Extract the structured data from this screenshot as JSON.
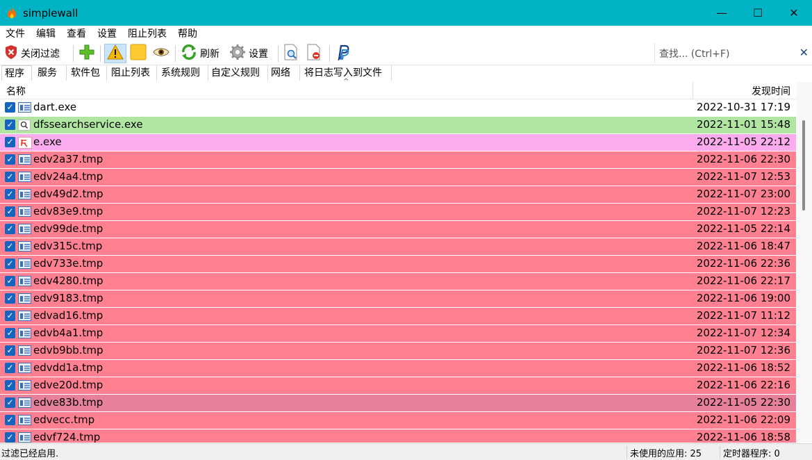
{
  "window": {
    "title": "simplewall",
    "minimize": "—",
    "maximize": "☐",
    "close": "✕"
  },
  "menu": [
    "文件",
    "编辑",
    "查看",
    "设置",
    "阻止列表",
    "帮助"
  ],
  "toolbar": {
    "disable_filter_label": "关闭过滤",
    "refresh_label": "刷新",
    "settings_label": "设置"
  },
  "search": {
    "placeholder": "查找... (Ctrl+F)",
    "clear": "✕"
  },
  "tabs": [
    "程序",
    "服务",
    "软件包",
    "阻止列表",
    "系统规则",
    "自定义规则",
    "网络",
    "将日志写入到文件"
  ],
  "columns": {
    "name": "名称",
    "time": "发现时间"
  },
  "colors": {
    "titlebar": "#00b4c6",
    "row_default": "#ffffff",
    "row_signed": "#b0e6a1",
    "row_special": "#fcacee",
    "row_unsigned": "#ff8091",
    "row_selected": "#e6809b"
  },
  "rows": [
    {
      "name": "dart.exe",
      "time": "2022-10-31 17:19",
      "color": "#ffffff",
      "icon": "app-window-icon"
    },
    {
      "name": "dfssearchservice.exe",
      "time": "2022-11-01 15:48",
      "color": "#b0e6a1",
      "icon": "search-icon"
    },
    {
      "name": "e.exe",
      "time": "2022-11-05 22:12",
      "color": "#fcacee",
      "icon": "app-e-icon"
    },
    {
      "name": "edv2a37.tmp",
      "time": "2022-11-06 22:30",
      "color": "#ff8091",
      "icon": "app-window-icon"
    },
    {
      "name": "edv24a4.tmp",
      "time": "2022-11-07 12:53",
      "color": "#ff8091",
      "icon": "app-window-icon"
    },
    {
      "name": "edv49d2.tmp",
      "time": "2022-11-07 23:00",
      "color": "#ff8091",
      "icon": "app-window-icon"
    },
    {
      "name": "edv83e9.tmp",
      "time": "2022-11-07 12:23",
      "color": "#ff8091",
      "icon": "app-window-icon"
    },
    {
      "name": "edv99de.tmp",
      "time": "2022-11-05 22:14",
      "color": "#ff8091",
      "icon": "app-window-icon"
    },
    {
      "name": "edv315c.tmp",
      "time": "2022-11-06 18:47",
      "color": "#ff8091",
      "icon": "app-window-icon"
    },
    {
      "name": "edv733e.tmp",
      "time": "2022-11-06 22:36",
      "color": "#ff8091",
      "icon": "app-window-icon"
    },
    {
      "name": "edv4280.tmp",
      "time": "2022-11-06 22:17",
      "color": "#ff8091",
      "icon": "app-window-icon"
    },
    {
      "name": "edv9183.tmp",
      "time": "2022-11-06 19:00",
      "color": "#ff8091",
      "icon": "app-window-icon"
    },
    {
      "name": "edvad16.tmp",
      "time": "2022-11-07 11:12",
      "color": "#ff8091",
      "icon": "app-window-icon"
    },
    {
      "name": "edvb4a1.tmp",
      "time": "2022-11-07 12:34",
      "color": "#ff8091",
      "icon": "app-window-icon"
    },
    {
      "name": "edvb9bb.tmp",
      "time": "2022-11-07 12:36",
      "color": "#ff8091",
      "icon": "app-window-icon"
    },
    {
      "name": "edvdd1a.tmp",
      "time": "2022-11-06 18:52",
      "color": "#ff8091",
      "icon": "app-window-icon"
    },
    {
      "name": "edve20d.tmp",
      "time": "2022-11-06 22:16",
      "color": "#ff8091",
      "icon": "app-window-icon"
    },
    {
      "name": "edve83b.tmp",
      "time": "2022-11-05 22:30",
      "color": "#e6809b",
      "icon": "app-window-icon"
    },
    {
      "name": "edvecc.tmp",
      "time": "2022-11-06 22:09",
      "color": "#ff8091",
      "icon": "app-window-icon"
    },
    {
      "name": "edvf724.tmp",
      "time": "2022-11-06 18:58",
      "color": "#ff8091",
      "icon": "app-window-icon"
    }
  ],
  "status": {
    "filter": "过滤已经启用.",
    "unused": "未使用的应用: 25",
    "timer": "定时器程序: 0"
  }
}
